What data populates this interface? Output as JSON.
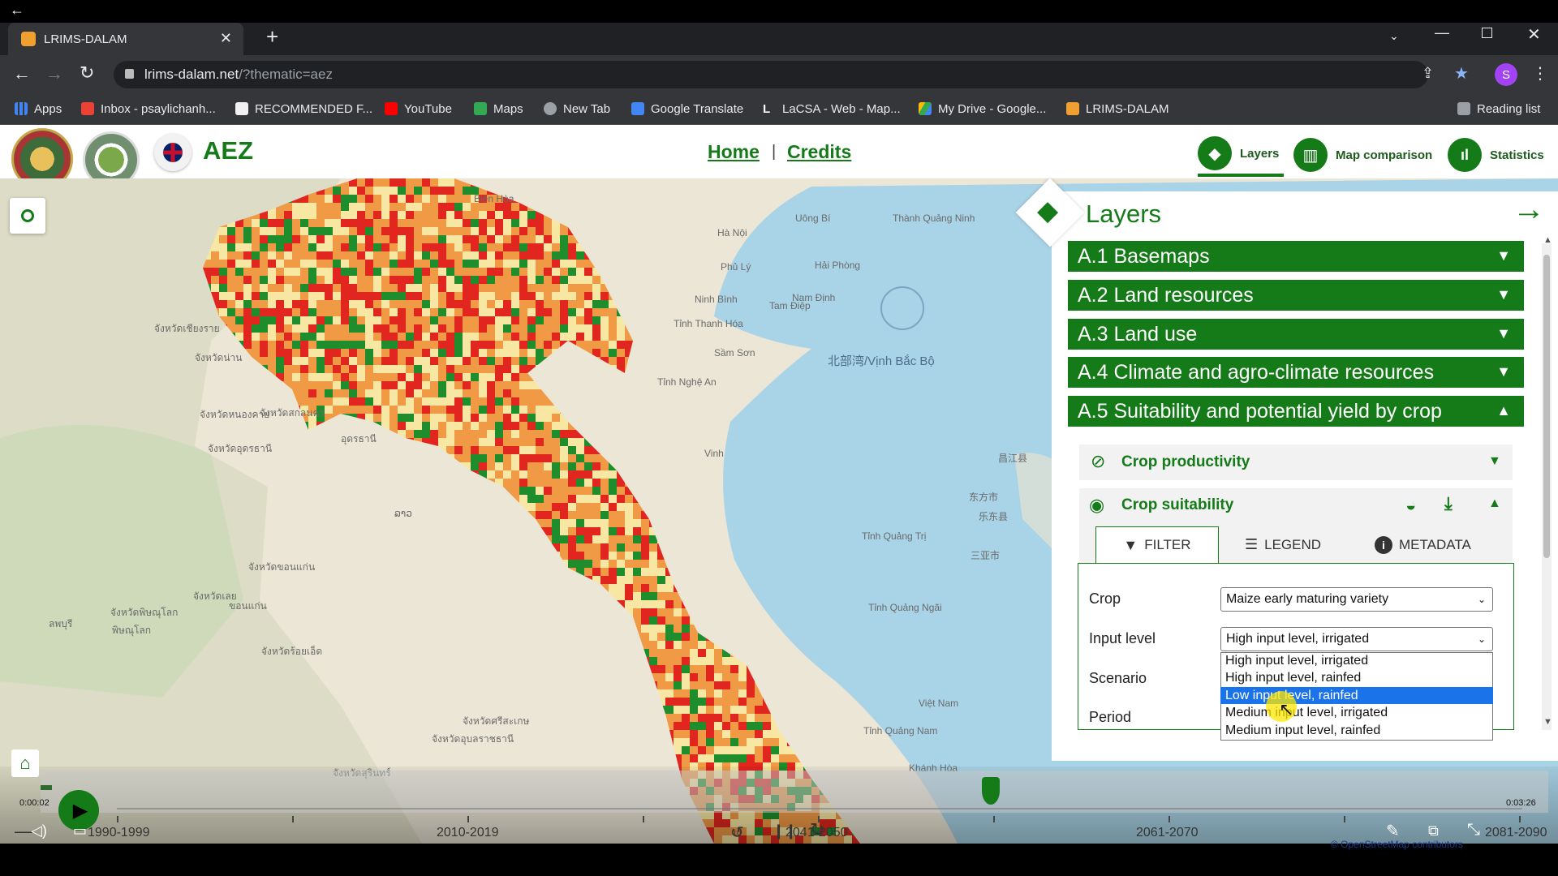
{
  "browser": {
    "tab_title": "LRIMS-DALAM",
    "url_domain": "lrims-dalam.net",
    "url_path": "/?thematic=aez",
    "profile_initial": "S",
    "reading_list": "Reading list",
    "bookmarks": [
      {
        "label": "Apps",
        "icon": "apps-grid-icon"
      },
      {
        "label": "Inbox - psaylichanh...",
        "icon": "gmail-icon"
      },
      {
        "label": "RECOMMENDED F...",
        "icon": "page-icon"
      },
      {
        "label": "YouTube",
        "icon": "youtube-icon"
      },
      {
        "label": "Maps",
        "icon": "maps-icon"
      },
      {
        "label": "New Tab",
        "icon": "globe-icon"
      },
      {
        "label": "Google Translate",
        "icon": "translate-icon"
      },
      {
        "label": "LaCSA - Web - Map...",
        "icon": "l-icon"
      },
      {
        "label": "My Drive - Google...",
        "icon": "drive-icon"
      },
      {
        "label": "LRIMS-DALAM",
        "icon": "lrims-icon"
      }
    ]
  },
  "app": {
    "title": "AEZ",
    "nav_home": "Home",
    "nav_separator": "|",
    "nav_credits": "Credits",
    "tools": [
      {
        "label": "Layers",
        "icon": "layers-icon"
      },
      {
        "label": "Map comparison",
        "icon": "map-compare-icon"
      },
      {
        "label": "Statistics",
        "icon": "bar-chart-icon"
      }
    ]
  },
  "layers_panel": {
    "title": "Layers",
    "sections": [
      {
        "label": "A.1 Basemaps",
        "expanded": false
      },
      {
        "label": "A.2 Land resources",
        "expanded": false
      },
      {
        "label": "A.3 Land use",
        "expanded": false
      },
      {
        "label": "A.4 Climate and agro-climate resources",
        "expanded": false
      },
      {
        "label": "A.5 Suitability and potential yield by crop",
        "expanded": true
      }
    ],
    "crop_productivity": "Crop productivity",
    "crop_suitability": "Crop suitability",
    "tabs": [
      "FILTER",
      "LEGEND",
      "METADATA"
    ],
    "filter": {
      "crop_label": "Crop",
      "crop_value": "Maize early maturing variety",
      "input_label": "Input level",
      "input_value": "High input level, irrigated",
      "scenario_label": "Scenario",
      "period_label": "Period",
      "input_options": [
        "High input level, irrigated",
        "High input level, rainfed",
        "Low input level, rainfed",
        "Medium input level, irrigated",
        "Medium input level, rainfed"
      ],
      "highlighted_option": 2
    }
  },
  "map_labels": [
    "Hà Nội",
    "Biên Hòa",
    "Uông Bí",
    "Thành Quảng Ninh",
    "Phủ Lý",
    "Hải Phòng",
    "Nam Định",
    "Ninh Bình",
    "Tam Điệp",
    "Tỉnh Thanh Hóa",
    "Sầm Sơn",
    "北部湾/Vịnh Bắc Bộ",
    "Tỉnh Nghệ An",
    "Vinh",
    "Tỉnh Quảng Trị",
    "Tỉnh Quảng Ngãi",
    "Việt Nam",
    "Tỉnh Quảng Nam",
    "Khánh Hòa",
    "东方市",
    "乐东县",
    "三亚市",
    "昌江县",
    "ລາວ",
    "จังหวัดเชียงราย",
    "จังหวัดน่าน",
    "จังหวัดหนองคาย",
    "จังหวัดอุดรธานี",
    "จังหวัดสกลนคร",
    "จังหวัดขอนแก่น",
    "จังหวัดเลย",
    "จังหวัดพิษณุโลก",
    "จังหวัดร้อยเอ็ด",
    "พิษณุโลก",
    "ขอนแก่น",
    "อุดรธานี",
    "จังหวัดศรีสะเกษ",
    "จังหวัดอุบลราชธานี",
    "จังหวัดสุรินทร์",
    "ลพบุรี"
  ],
  "player": {
    "time_current": "0:00:02",
    "time_total": "0:03:26",
    "scrub_fraction": 0.008,
    "timeline_labels": [
      "1990-1999",
      "2010-2019",
      "2041-2050",
      "2061-2070",
      "2081-2090"
    ],
    "timeline_marker_index": 3,
    "replay_seconds": "10",
    "forward_seconds": "30",
    "attribution": "© OpenStreetMap contributors"
  },
  "colors": {
    "green": "#157a18",
    "red": "#e0261e",
    "orange": "#f09a45",
    "yellow": "#f8e7a3",
    "dark_green": "#1f8d2b",
    "highlight": "#1a73e8"
  }
}
